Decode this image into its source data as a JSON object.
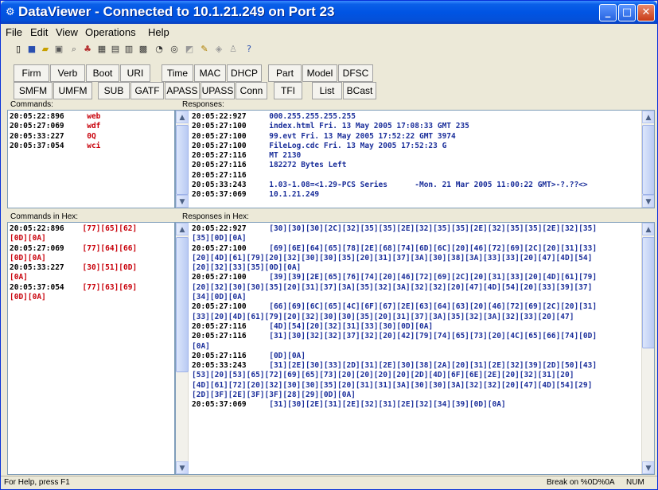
{
  "window": {
    "title": "DataViewer - Connected to 10.1.21.249 on Port 23"
  },
  "menu": [
    "File",
    "Edit",
    "View",
    "Operations",
    "Help"
  ],
  "toolbar_icons": [
    "new-icon",
    "save-icon",
    "open-icon",
    "print-icon",
    "find-icon",
    "copy-icon",
    "paste-icon",
    "grid-icon",
    "layout-icon",
    "chart-icon",
    "refresh-icon",
    "settings-icon",
    "edit-icon",
    "pencil-icon",
    "graph-icon",
    "user-icon",
    "help-icon"
  ],
  "row1_buttons": [
    "Firm",
    "Verb",
    "Boot",
    "URI",
    "Time",
    "MAC",
    "DHCP",
    "Part",
    "Model",
    "DFSC"
  ],
  "row2_buttons": [
    "SMFM",
    "UMFM",
    "SUB",
    "GATF",
    "APASS",
    "UPASS",
    "Conn",
    "TFI",
    "List",
    "BCast"
  ],
  "commands": {
    "label": "Commands:",
    "rows": [
      {
        "ts": "20:05:22:896",
        "cmd": "web"
      },
      {
        "ts": "20:05:27:069",
        "cmd": "wdf"
      },
      {
        "ts": "20:05:33:227",
        "cmd": "0Q"
      },
      {
        "ts": "20:05:37:054",
        "cmd": "wci"
      }
    ]
  },
  "responses": {
    "label": "Responses:",
    "rows": [
      {
        "ts": "20:05:22:927",
        "text": "000.255.255.255.255"
      },
      {
        "ts": "20:05:27:100",
        "text": "index.html Fri. 13 May 2005 17:08:33 GMT 235"
      },
      {
        "ts": "20:05:27:100",
        "text": "99.evt Fri. 13 May 2005 17:52:22 GMT 3974"
      },
      {
        "ts": "20:05:27:100",
        "text": "FileLog.cdc Fri. 13 May 2005 17:52:23 G"
      },
      {
        "ts": "20:05:27:116",
        "text": "MT 2130"
      },
      {
        "ts": "20:05:27:116",
        "text": "182272 Bytes Left"
      },
      {
        "ts": "20:05:27:116",
        "text": ""
      },
      {
        "ts": "20:05:33:243",
        "text": "1.03-1.08=<1.29-PCS Series      -Mon. 21 Mar 2005 11:00:22 GMT>-?.??<>"
      },
      {
        "ts": "20:05:37:069",
        "text": "10.1.21.249"
      }
    ]
  },
  "commands_hex": {
    "label": "Commands in Hex:",
    "lines": [
      {
        "ts": "20:05:22:896",
        "hex": "[77][65][62]"
      },
      {
        "ts": "",
        "hex": "[0D][0A]"
      },
      {
        "ts": "20:05:27:069",
        "hex": "[77][64][66]"
      },
      {
        "ts": "",
        "hex": "[0D][0A]"
      },
      {
        "ts": "20:05:33:227",
        "hex": "[30][51][0D]"
      },
      {
        "ts": "",
        "hex": "[0A]"
      },
      {
        "ts": "20:05:37:054",
        "hex": "[77][63][69]"
      },
      {
        "ts": "",
        "hex": "[0D][0A]"
      }
    ]
  },
  "responses_hex": {
    "label": "Responses in Hex:",
    "lines": [
      {
        "ts": "20:05:22:927",
        "hex": "[30][30][30][2C][32][35][35][2E][32][35][35][2E][32][35][35][2E][32][35]"
      },
      {
        "ts": "",
        "hex": "[35][0D][0A]"
      },
      {
        "ts": "20:05:27:100",
        "hex": "[69][6E][64][65][78][2E][68][74][6D][6C][20][46][72][69][2C][20][31][33]"
      },
      {
        "ts": "",
        "hex": "[20][4D][61][79][20][32][30][30][35][20][31][37][3A][30][38][3A][33][33][20][47][4D][54]"
      },
      {
        "ts": "",
        "hex": "[20][32][33][35][0D][0A]"
      },
      {
        "ts": "20:05:27:100",
        "hex": "[39][39][2E][65][76][74][20][46][72][69][2C][20][31][33][20][4D][61][79]"
      },
      {
        "ts": "",
        "hex": "[20][32][30][30][35][20][31][37][3A][35][32][3A][32][32][20][47][4D][54][20][33][39][37]"
      },
      {
        "ts": "",
        "hex": "[34][0D][0A]"
      },
      {
        "ts": "20:05:27:100",
        "hex": "[66][69][6C][65][4C][6F][67][2E][63][64][63][20][46][72][69][2C][20][31]"
      },
      {
        "ts": "",
        "hex": "[33][20][4D][61][79][20][32][30][30][35][20][31][37][3A][35][32][3A][32][33][20][47]"
      },
      {
        "ts": "20:05:27:116",
        "hex": "[4D][54][20][32][31][33][30][0D][0A]"
      },
      {
        "ts": "20:05:27:116",
        "hex": "[31][30][32][32][37][32][20][42][79][74][65][73][20][4C][65][66][74][0D]"
      },
      {
        "ts": "",
        "hex": "[0A]"
      },
      {
        "ts": "20:05:27:116",
        "hex": "[0D][0A]"
      },
      {
        "ts": "20:05:33:243",
        "hex": "[31][2E][30][33][2D][31][2E][30][38][2A][20][31][2E][32][39][2D][50][43]"
      },
      {
        "ts": "",
        "hex": "[53][20][53][65][72][69][65][73][20][20][20][20][2D][4D][6F][6E][2E][20][32][31][20]"
      },
      {
        "ts": "",
        "hex": "[4D][61][72][20][32][30][30][35][20][31][31][3A][30][30][3A][32][32][20][47][4D][54][29]"
      },
      {
        "ts": "",
        "hex": "[2D][3F][2E][3F][3F][28][29][0D][0A]"
      },
      {
        "ts": "20:05:37:069",
        "hex": "[31][30][2E][31][2E][32][31][2E][32][34][39][0D][0A]"
      }
    ]
  },
  "status": {
    "help": "For Help, press F1",
    "break": "Break on %0D%0A",
    "num": "NUM"
  }
}
